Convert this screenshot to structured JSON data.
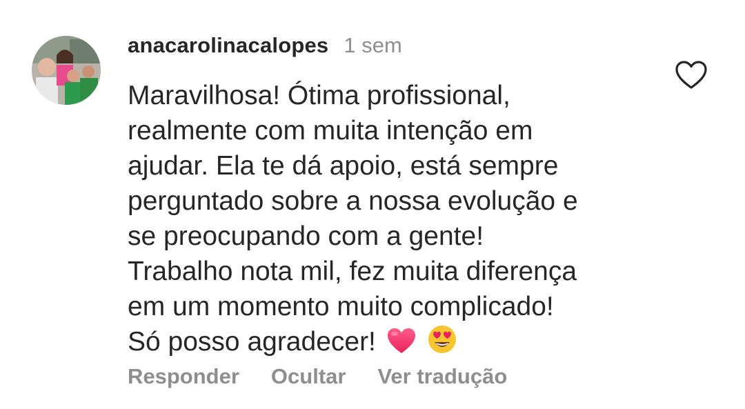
{
  "comment": {
    "username": "anacarolinacalopes",
    "time": "1 sem",
    "text_lines": [
      "Maravilhosa! Ótima profissional,",
      "realmente com muita intenção em",
      "ajudar. Ela te dá apoio, está sempre",
      "perguntado sobre a nossa evolução e",
      "se preocupando com a gente!",
      "Trabalho nota mil, fez muita diferença",
      "em um momento muito complicado!",
      "Só posso agradecer!"
    ],
    "emojis": [
      "red-heart",
      "heart-eyes-face"
    ],
    "like_icon": "heart-outline-icon",
    "actions": {
      "reply": "Responder",
      "hide": "Ocultar",
      "translate": "Ver tradução"
    }
  },
  "colors": {
    "text": "#262626",
    "secondary": "#8e8e8e",
    "heart_emoji": "#f0346e",
    "face_emoji": "#f7c52f"
  }
}
